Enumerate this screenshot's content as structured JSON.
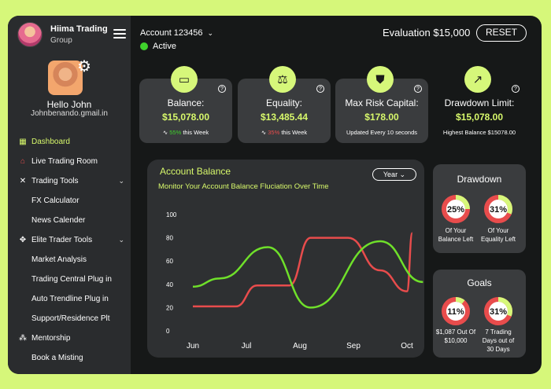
{
  "brand": {
    "name": "Hiima Trading",
    "sub": "Group"
  },
  "profile": {
    "hello": "Hello John",
    "email": "Johnbenando.gmail.in"
  },
  "nav": [
    {
      "label": "Dashboard",
      "icon": "dashboard-icon",
      "glyph": "▦",
      "active": true,
      "sub": false,
      "chev": ""
    },
    {
      "label": "Live Trading Room",
      "icon": "home-icon",
      "glyph": "⌂",
      "active": false,
      "sub": false,
      "chev": ""
    },
    {
      "label": "Trading Tools",
      "icon": "tools-icon",
      "glyph": "✕",
      "active": false,
      "sub": false,
      "chev": "⌄"
    },
    {
      "label": "FX Calculator",
      "icon": "",
      "glyph": "",
      "active": false,
      "sub": true,
      "chev": ""
    },
    {
      "label": "News Calender",
      "icon": "",
      "glyph": "",
      "active": false,
      "sub": true,
      "chev": ""
    },
    {
      "label": "Elite Trader Tools",
      "icon": "elite-icon",
      "glyph": "✥",
      "active": false,
      "sub": false,
      "chev": "⌄"
    },
    {
      "label": "Market Analysis",
      "icon": "",
      "glyph": "",
      "active": false,
      "sub": true,
      "chev": ""
    },
    {
      "label": "Trading Central Plug in",
      "icon": "",
      "glyph": "",
      "active": false,
      "sub": true,
      "chev": ""
    },
    {
      "label": "Auto Trendline Plug in",
      "icon": "",
      "glyph": "",
      "active": false,
      "sub": true,
      "chev": ""
    },
    {
      "label": "Support/Residence Plt",
      "icon": "",
      "glyph": "",
      "active": false,
      "sub": true,
      "chev": ""
    },
    {
      "label": "Mentorship",
      "icon": "users-icon",
      "glyph": "⁂",
      "active": false,
      "sub": false,
      "chev": ""
    },
    {
      "label": "Book a Misting",
      "icon": "",
      "glyph": "",
      "active": false,
      "sub": true,
      "chev": ""
    }
  ],
  "header": {
    "account": "Account 123456",
    "status": "Active",
    "evaluation": "Evaluation $15,000",
    "reset": "RESET"
  },
  "cards": [
    {
      "label": "Balance:",
      "value": "$15,078.00",
      "change": "55%",
      "change_dir": "up",
      "suffix": " this Week",
      "icon": "wallet-icon",
      "glyph": "▭"
    },
    {
      "label": "Equality:",
      "value": "$13,485.44",
      "change": "35%",
      "change_dir": "down",
      "suffix": " this Week",
      "icon": "scale-icon",
      "glyph": "⚖"
    },
    {
      "label": "Max Risk Capital:",
      "value": "$178.00",
      "change": "",
      "change_dir": "",
      "suffix": "Updated Every 10 seconds",
      "icon": "shield-icon",
      "glyph": "⛊"
    },
    {
      "label": "Drawdown Limit:",
      "value": "$15,078.00",
      "change": "",
      "change_dir": "",
      "suffix": "Highest Balance $15078.00",
      "icon": "trend-icon",
      "glyph": "↗"
    }
  ],
  "chart_card": {
    "title": "Account Balance",
    "subtitle": "Monitor Your Account Balance Fluciation Over Time",
    "range": "Year ⌄"
  },
  "chart_data": {
    "type": "line",
    "x": [
      "Jun",
      "Jul",
      "Aug",
      "Sep",
      "Oct"
    ],
    "ylim": [
      0,
      100
    ],
    "yticks": [
      0,
      20,
      40,
      60,
      80,
      100
    ],
    "series": [
      {
        "color": "#e84c4c",
        "points": [
          [
            0,
            21
          ],
          [
            0.8,
            21
          ],
          [
            1.2,
            39
          ],
          [
            1.8,
            39
          ],
          [
            2.2,
            80
          ],
          [
            2.9,
            80
          ],
          [
            3.5,
            52
          ],
          [
            4.0,
            34
          ],
          [
            4.1,
            84
          ]
        ]
      },
      {
        "color": "#6fe02a",
        "points": [
          [
            0,
            38
          ],
          [
            0.5,
            45
          ],
          [
            1.4,
            72
          ],
          [
            2.2,
            20
          ],
          [
            3.5,
            77
          ],
          [
            4.3,
            42
          ]
        ]
      }
    ]
  },
  "drawdown": {
    "title": "Drawdown",
    "items": [
      {
        "percent": "25%",
        "fraction": 0.25,
        "label1": "Of Your",
        "label2": "Balance Left"
      },
      {
        "percent": "31%",
        "fraction": 0.31,
        "label1": "Of Your",
        "label2": "Equality Left"
      }
    ]
  },
  "goals": {
    "title": "Goals",
    "items": [
      {
        "percent": "11%",
        "fraction": 0.11,
        "label1": "$1,087 Out Of",
        "label2": "$10,000",
        "label3": ""
      },
      {
        "percent": "31%",
        "fraction": 0.31,
        "label1": "7 Trading",
        "label2": "Days out of",
        "label3": "30 Days"
      }
    ]
  },
  "colors": {
    "accent": "#d6f77a",
    "red": "#e84c4c",
    "green": "#6fe02a"
  }
}
